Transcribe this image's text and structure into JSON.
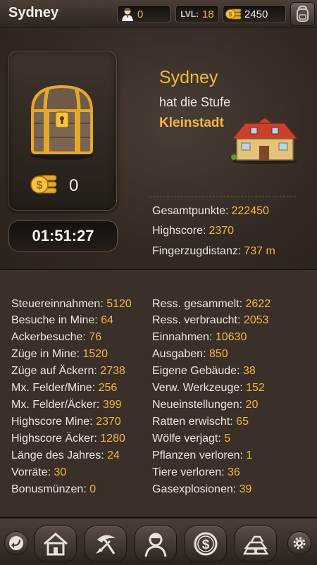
{
  "topbar": {
    "title": "Sydney",
    "workers": "0",
    "level_label": "LVL:",
    "level_value": "18",
    "coins": "2450"
  },
  "profile": {
    "chest_coins": "0",
    "timer": "01:51:27",
    "city_name": "Sydney",
    "stage_text": "hat die Stufe",
    "stage_name": "Kleinstadt",
    "scores": [
      {
        "label": "Gesamtpunkte:",
        "value": "222450"
      },
      {
        "label": "Highscore:",
        "value": "2370"
      },
      {
        "label": "Fingerzugdistanz:",
        "value": "737 m"
      }
    ]
  },
  "stats": {
    "left": [
      {
        "label": "Steuereinnahmen:",
        "value": "5120"
      },
      {
        "label": "Besuche in Mine:",
        "value": "64"
      },
      {
        "label": "Ackerbesuche:",
        "value": "76"
      },
      {
        "label": "Züge in Mine:",
        "value": "1520"
      },
      {
        "label": "Züge auf Äckern:",
        "value": "2738"
      },
      {
        "label": "Mx. Felder/Mine:",
        "value": "256"
      },
      {
        "label": "Mx. Felder/Äcker:",
        "value": "399"
      },
      {
        "label": "Highscore Mine:",
        "value": "2370"
      },
      {
        "label": "Highscore Äcker:",
        "value": "1280"
      },
      {
        "label": "Länge des Jahres:",
        "value": "24"
      },
      {
        "label": "Vorräte:",
        "value": "30"
      },
      {
        "label": "Bonusmünzen:",
        "value": "0"
      }
    ],
    "right": [
      {
        "label": "Ress. gesammelt:",
        "value": "2622"
      },
      {
        "label": "Ress. verbraucht:",
        "value": "2053"
      },
      {
        "label": "Einnahmen:",
        "value": "10630"
      },
      {
        "label": "Ausgaben:",
        "value": "850"
      },
      {
        "label": "Eigene Gebäude:",
        "value": "38"
      },
      {
        "label": "Verw. Werkzeuge:",
        "value": "152"
      },
      {
        "label": "Neueinstellungen:",
        "value": "20"
      },
      {
        "label": "Ratten erwischt:",
        "value": "65"
      },
      {
        "label": "Wölfe verjagt:",
        "value": "5"
      },
      {
        "label": "Pflanzen verloren:",
        "value": "1"
      },
      {
        "label": "Tiere verloren:",
        "value": "36"
      },
      {
        "label": "Gasexplosionen:",
        "value": "39"
      }
    ]
  },
  "icons": {
    "workers": "worker-icon",
    "coins": "gold-coin-stack-icon",
    "bag": "backpack-icon",
    "chest": "treasure-chest-icon",
    "house": "town-house-icon",
    "nav": [
      "back-arrow-icon",
      "house-icon",
      "shovel-pickaxe-icon",
      "worker-portrait-icon",
      "dollar-coin-icon",
      "gold-bars-icon",
      "gear-icon"
    ]
  },
  "colors": {
    "accent": "#f1b643",
    "text": "#ebe6dc",
    "background": "#3a3029"
  }
}
